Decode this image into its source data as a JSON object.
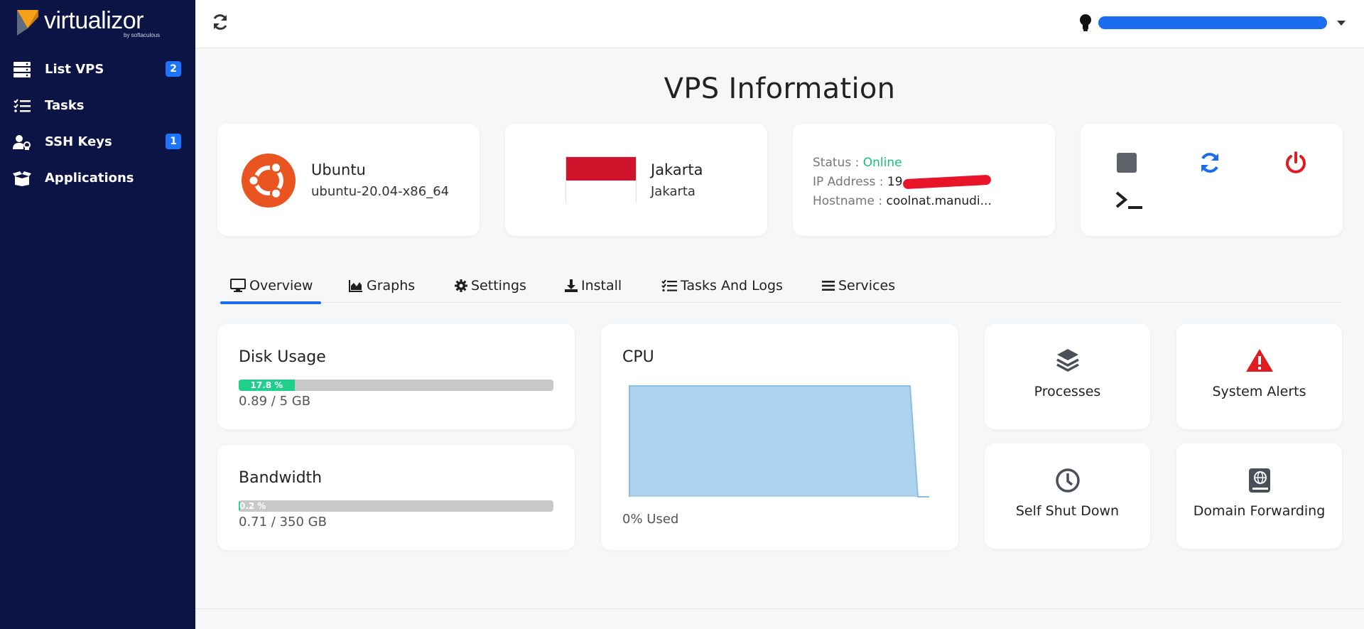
{
  "brand": {
    "name": "virtualizor",
    "sub": "by softaculous"
  },
  "sidebar": {
    "items": [
      {
        "label": "List VPS",
        "icon": "server-list-icon",
        "badge": "2"
      },
      {
        "label": "Tasks",
        "icon": "task-list-icon",
        "badge": ""
      },
      {
        "label": "SSH Keys",
        "icon": "user-key-icon",
        "badge": "1"
      },
      {
        "label": "Applications",
        "icon": "box-open-icon",
        "badge": ""
      }
    ]
  },
  "topbar": {
    "refresh_icon": "refresh-icon",
    "user_icon": "lightbulb-icon"
  },
  "page": {
    "title": "VPS Information"
  },
  "os": {
    "name": "Ubuntu",
    "version": "ubuntu-20.04-x86_64"
  },
  "location": {
    "city": "Jakarta",
    "region": "Jakarta"
  },
  "server": {
    "status_label": "Status :",
    "status_value": "Online",
    "ip_label": "IP Address :",
    "ip_value": "19",
    "hostname_label": "Hostname :",
    "hostname_value": "coolnat.manudi..."
  },
  "tabs": [
    {
      "label": "Overview",
      "icon": "desktop-icon"
    },
    {
      "label": "Graphs",
      "icon": "area-chart-icon"
    },
    {
      "label": "Settings",
      "icon": "gear-icon"
    },
    {
      "label": "Install",
      "icon": "download-icon"
    },
    {
      "label": "Tasks And Logs",
      "icon": "task-list-icon"
    },
    {
      "label": "Services",
      "icon": "list-icon"
    }
  ],
  "disk": {
    "title": "Disk Usage",
    "percent_label": "17.8 %",
    "percent": 17.8,
    "amount": "0.89 / 5 GB"
  },
  "bandwidth": {
    "title": "Bandwidth",
    "percent_label": "0.2 %",
    "percent": 0.2,
    "amount": "0.71 / 350 GB"
  },
  "cpu": {
    "title": "CPU",
    "used_label": "0% Used"
  },
  "tiles": {
    "processes": "Processes",
    "alerts": "System Alerts",
    "shutdown": "Self Shut Down",
    "forwarding": "Domain Forwarding"
  },
  "colors": {
    "sidebar_bg": "#0c1445",
    "accent": "#1c6cf0",
    "online": "#18c07b",
    "progress": "#1fcf8b",
    "danger": "#e11b22",
    "cpu_fill": "#acd3ee"
  }
}
